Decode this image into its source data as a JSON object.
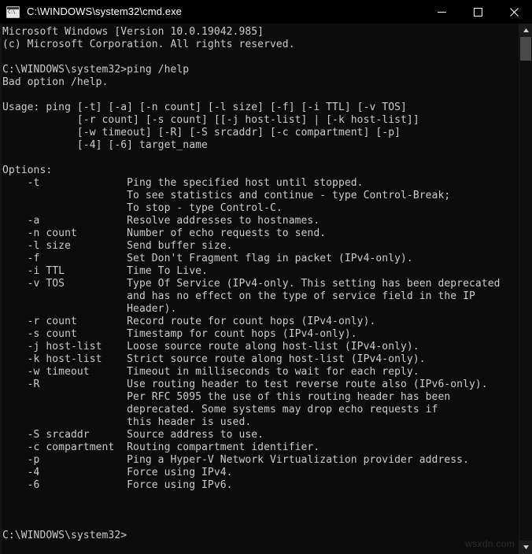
{
  "window": {
    "title": "C:\\WINDOWS\\system32\\cmd.exe",
    "icon": "console-icon",
    "background_color": "#0c0c0c",
    "text_color": "#cccccc",
    "titlebar_color": "#000000",
    "controls": {
      "minimize_label": "Minimize",
      "maximize_label": "Maximize",
      "close_label": "Close"
    }
  },
  "scrollbar": {
    "up_arrow_label": "Scroll up",
    "down_arrow_label": "Scroll down",
    "thumb_label": "Scroll thumb"
  },
  "watermark": {
    "text": "wsxdn.com"
  },
  "console": {
    "banner": [
      "Microsoft Windows [Version 10.0.19042.985]",
      "(c) Microsoft Corporation. All rights reserved."
    ],
    "prompt": "C:\\WINDOWS\\system32>",
    "command": "ping /help",
    "error": "Bad option /help.",
    "usage": [
      "Usage: ping [-t] [-a] [-n count] [-l size] [-f] [-i TTL] [-v TOS]",
      "            [-r count] [-s count] [[-j host-list] | [-k host-list]]",
      "            [-w timeout] [-R] [-S srcaddr] [-c compartment] [-p]",
      "            [-4] [-6] target_name"
    ],
    "options_header": "Options:",
    "options": [
      {
        "flag": "-t",
        "lines": [
          "Ping the specified host until stopped.",
          "To see statistics and continue - type Control-Break;",
          "To stop - type Control-C."
        ]
      },
      {
        "flag": "-a",
        "lines": [
          "Resolve addresses to hostnames."
        ]
      },
      {
        "flag": "-n count",
        "lines": [
          "Number of echo requests to send."
        ]
      },
      {
        "flag": "-l size",
        "lines": [
          "Send buffer size."
        ]
      },
      {
        "flag": "-f",
        "lines": [
          "Set Don't Fragment flag in packet (IPv4-only)."
        ]
      },
      {
        "flag": "-i TTL",
        "lines": [
          "Time To Live."
        ]
      },
      {
        "flag": "-v TOS",
        "lines": [
          "Type Of Service (IPv4-only. This setting has been deprecated",
          "and has no effect on the type of service field in the IP",
          "Header)."
        ]
      },
      {
        "flag": "-r count",
        "lines": [
          "Record route for count hops (IPv4-only)."
        ]
      },
      {
        "flag": "-s count",
        "lines": [
          "Timestamp for count hops (IPv4-only)."
        ]
      },
      {
        "flag": "-j host-list",
        "lines": [
          "Loose source route along host-list (IPv4-only)."
        ]
      },
      {
        "flag": "-k host-list",
        "lines": [
          "Strict source route along host-list (IPv4-only)."
        ]
      },
      {
        "flag": "-w timeout",
        "lines": [
          "Timeout in milliseconds to wait for each reply."
        ]
      },
      {
        "flag": "-R",
        "lines": [
          "Use routing header to test reverse route also (IPv6-only).",
          "Per RFC 5095 the use of this routing header has been",
          "deprecated. Some systems may drop echo requests if",
          "this header is used."
        ]
      },
      {
        "flag": "-S srcaddr",
        "lines": [
          "Source address to use."
        ]
      },
      {
        "flag": "-c compartment",
        "lines": [
          "Routing compartment identifier."
        ]
      },
      {
        "flag": "-p",
        "lines": [
          "Ping a Hyper-V Network Virtualization provider address."
        ]
      },
      {
        "flag": "-4",
        "lines": [
          "Force using IPv4."
        ]
      },
      {
        "flag": "-6",
        "lines": [
          "Force using IPv6."
        ]
      }
    ],
    "flag_indent": 4,
    "desc_column": 20,
    "blank_lines_before_final_prompt": 3
  }
}
